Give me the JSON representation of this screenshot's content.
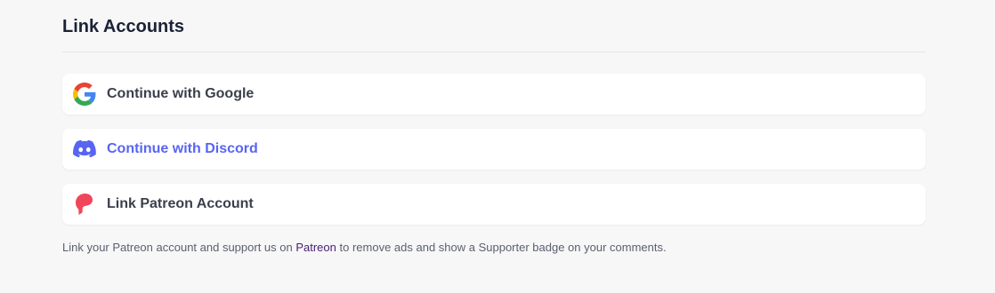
{
  "section": {
    "title": "Link Accounts"
  },
  "buttons": {
    "google": {
      "label": "Continue with Google",
      "icon": "google-icon"
    },
    "discord": {
      "label": "Continue with Discord",
      "icon": "discord-icon",
      "color": "#5865f2"
    },
    "patreon": {
      "label": "Link Patreon Account",
      "icon": "patreon-icon",
      "color": "#f1465a"
    }
  },
  "note": {
    "before": "Link your Patreon account and support us on ",
    "link": "Patreon",
    "after": " to remove ads and show a Supporter badge on your comments."
  }
}
